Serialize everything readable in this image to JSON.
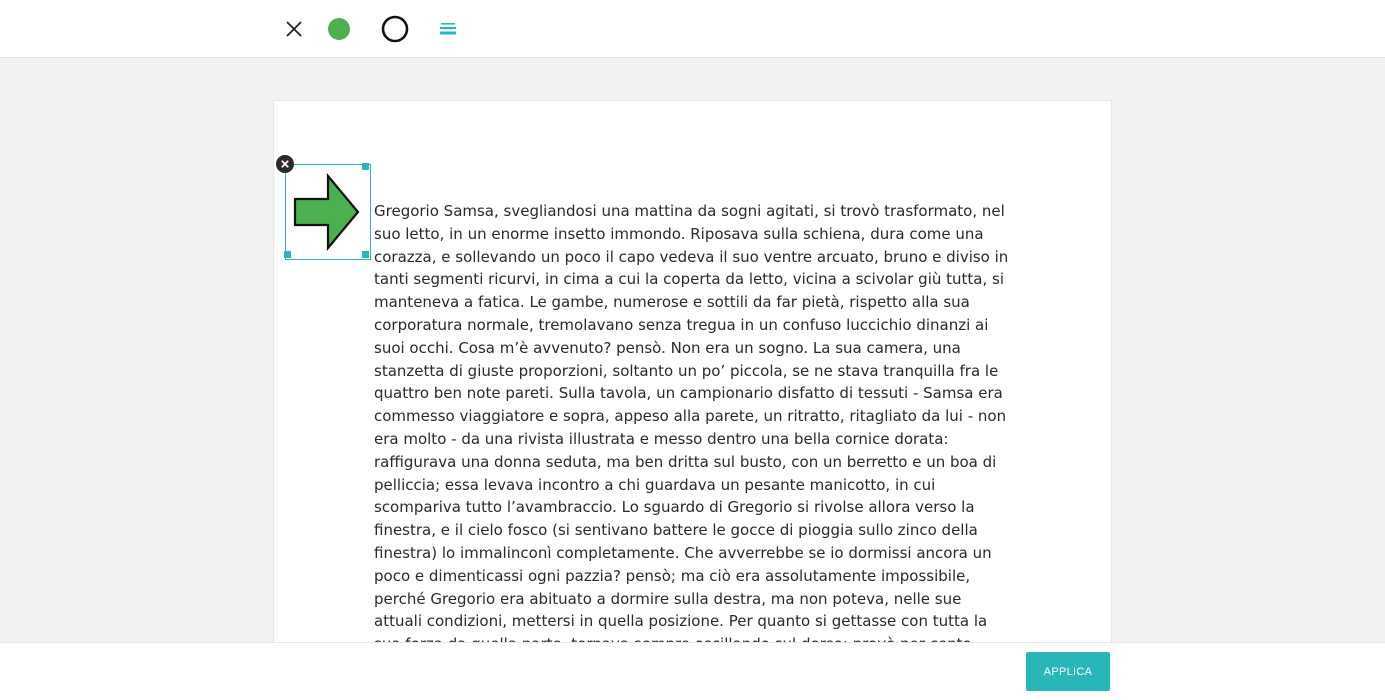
{
  "toolbar": {
    "close_icon": "close-icon",
    "fill_color_icon": "fill-color-icon",
    "fill_color": "#4caf50",
    "stroke_icon": "stroke-color-icon",
    "stroke_color": "#111111",
    "line_style_icon": "line-style-icon",
    "accent_color": "#29b6b8"
  },
  "editor": {
    "selected_shape": "arrow-right",
    "shape_fill": "#4caf50",
    "delete_icon": "delete-shape-icon",
    "text": "Gregorio Samsa, svegliandosi una mattina da sogni agitati, si trovò trasformato, nel suo letto, in un enorme insetto immondo. Riposava sulla schiena, dura come una corazza, e sollevando un poco il capo vedeva il suo ventre arcuato, bruno e diviso in tanti segmenti ricurvi, in cima a cui la coperta da letto, vicina a scivolar giù tutta, si manteneva a fatica. Le gambe, numerose e sottili da far pietà, rispetto alla sua corporatura normale, tremolavano senza tregua in un confuso luccichio dinanzi ai suoi occhi. Cosa m’è avvenuto? pensò. Non era un sogno. La sua camera, una stanzetta di giuste proporzioni, soltanto un po’ piccola, se ne stava tranquilla fra le quattro ben note pareti. Sulla tavola, un campionario disfatto di tessuti - Samsa era commesso viaggiatore e sopra, appeso alla parete, un ritratto, ritagliato da lui - non era molto - da una rivista illustrata e messo dentro una bella cornice dorata: raffigurava una donna seduta, ma ben dritta sul busto, con un berretto e un boa di pelliccia; essa levava incontro a chi guardava un pesante manicotto, in cui scompariva tutto l’avambraccio. Lo sguardo di Gregorio si rivolse allora verso la finestra, e il cielo fosco (si sentivano battere le gocce di pioggia sullo zinco della finestra) lo immalinconì completamente. Che avverrebbe se io dormissi ancora un poco e dimenticassi ogni pazzia? pensò; ma ciò era assolutamente impossibile, perché Gregorio era abituato a dormire sulla destra, ma non poteva, nelle sue attuali condizioni, mettersi in quella posizione. Per quanto si gettasse con tutta la sua forza da quella parte, tornava sempre oscillando sul dorso: provò per cento volte, chiuse gli occhi per non veder le sue zampine dimenanti, e rinunciò soltanto quando cominciò a sentire nel"
  },
  "footer": {
    "apply_label": "APPLICA"
  }
}
